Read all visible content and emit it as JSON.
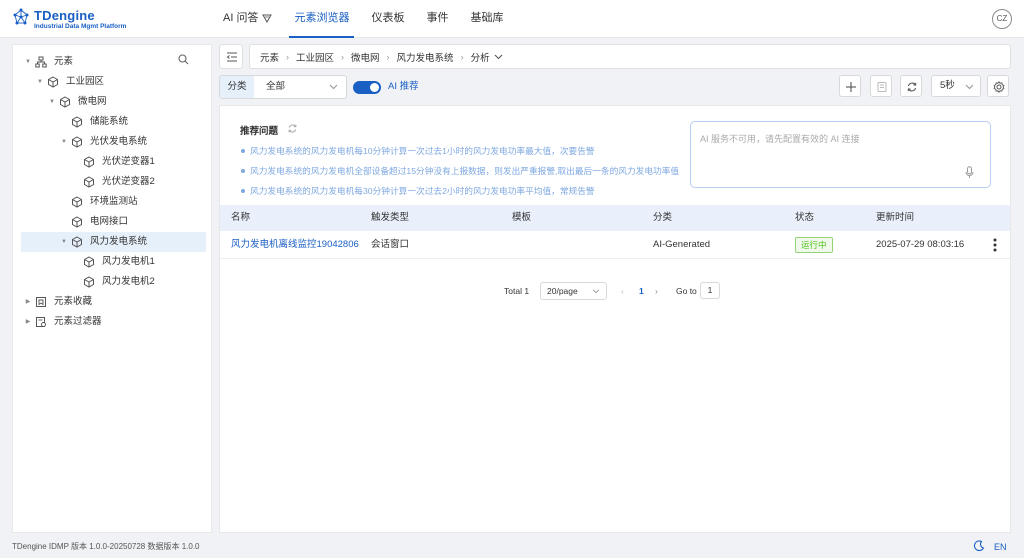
{
  "app": {
    "logo_title": "TDengine",
    "logo_subtitle": "Industrial Data Mgmt Platform",
    "user_initials": "CZ"
  },
  "nav": {
    "items": [
      {
        "label": "AI 问答",
        "active": false
      },
      {
        "label": "元素浏览器",
        "active": true
      },
      {
        "label": "仪表板",
        "active": false
      },
      {
        "label": "事件",
        "active": false
      },
      {
        "label": "基础库",
        "active": false
      }
    ]
  },
  "sidebar": {
    "tree": [
      {
        "label": "元素",
        "icon": "network-icon",
        "expanded": true
      },
      {
        "label": "工业园区",
        "icon": "cube-icon",
        "expanded": true
      },
      {
        "label": "微电网",
        "icon": "cube-icon",
        "expanded": true
      },
      {
        "label": "储能系统",
        "icon": "cube-icon"
      },
      {
        "label": "光伏发电系统",
        "icon": "cube-icon",
        "expanded": true
      },
      {
        "label": "光伏逆变器1",
        "icon": "cube-icon"
      },
      {
        "label": "光伏逆变器2",
        "icon": "cube-icon"
      },
      {
        "label": "环境监测站",
        "icon": "cube-icon"
      },
      {
        "label": "电网接口",
        "icon": "cube-icon"
      },
      {
        "label": "风力发电系统",
        "icon": "cube-icon",
        "expanded": true,
        "selected": true
      },
      {
        "label": "风力发电机1",
        "icon": "cube-icon"
      },
      {
        "label": "风力发电机2",
        "icon": "cube-icon"
      },
      {
        "label": "元素收藏",
        "icon": "bookmark-icon",
        "expanded": false
      },
      {
        "label": "元素过滤器",
        "icon": "filter-icon",
        "expanded": false
      }
    ]
  },
  "breadcrumb": [
    "元素",
    "工业园区",
    "微电网",
    "风力发电系统",
    "分析"
  ],
  "toolbar": {
    "category_label": "分类",
    "category_value": "全部",
    "ai_toggle_label": "AI 推荐",
    "ai_toggle_on": true,
    "refresh_interval": "5秒"
  },
  "recommend": {
    "title": "推荐问题",
    "questions": [
      "风力发电系统的风力发电机每10分钟计算一次过去1小时的风力发电功率最大值，次要告警",
      "风力发电系统的风力发电机全部设备超过15分钟没有上报数据，则发出严重报警,取出最后一条的风力发电功率值",
      "风力发电系统的风力发电机每30分钟计算一次过去2小时的风力发电功率平均值，常规告警"
    ],
    "ai_placeholder": "AI 服务不可用，请先配置有效的 AI 连接"
  },
  "table": {
    "headers": [
      "名称",
      "触发类型",
      "模板",
      "分类",
      "状态",
      "更新时间"
    ],
    "rows": [
      {
        "name": "风力发电机离线监控19042806",
        "trigger": "会话窗口",
        "template": "",
        "category": "AI-Generated",
        "status": "运行中",
        "updated": "2025-07-29 08:03:16"
      }
    ]
  },
  "pagination": {
    "total": "Total 1",
    "page_size": "20/page",
    "current_page": "1",
    "goto_label": "Go to",
    "goto_value": "1"
  },
  "footer": {
    "version": "TDengine IDMP 版本 1.0.0-20250728 数据版本 1.0.0",
    "lang": "EN"
  },
  "colors": {
    "accent": "#1a5fc4",
    "status_running": "#52c41a",
    "recommend_link": "#7fa8e0",
    "table_header_bg": "#e9f0fb"
  }
}
